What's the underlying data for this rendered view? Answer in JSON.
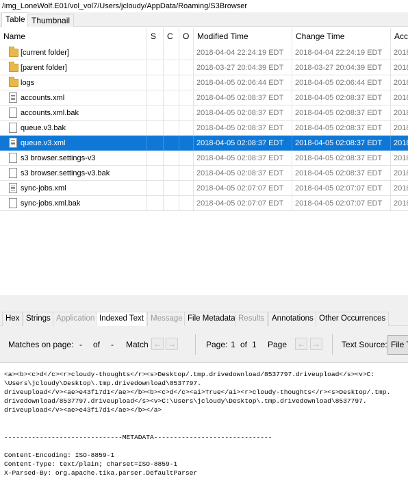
{
  "path": "/img_LoneWolf.E01/vol_vol7/Users/jcloudy/AppData/Roaming/S3Browser",
  "view_tabs": [
    "Table",
    "Thumbnail"
  ],
  "columns": [
    "Name",
    "S",
    "C",
    "O",
    "Modified Time",
    "Change Time",
    "Access"
  ],
  "rows": [
    {
      "name": "[current folder]",
      "icon": "folder-icon",
      "modified": "2018-04-04 22:24:19 EDT",
      "changed": "2018-04-04 22:24:19 EDT",
      "access": "2018"
    },
    {
      "name": "[parent folder]",
      "icon": "folder-icon",
      "modified": "2018-03-27 20:04:39 EDT",
      "changed": "2018-03-27 20:04:39 EDT",
      "access": "2018"
    },
    {
      "name": "logs",
      "icon": "folder-icon",
      "modified": "2018-04-05 02:06:44 EDT",
      "changed": "2018-04-05 02:06:44 EDT",
      "access": "2018"
    },
    {
      "name": "accounts.xml",
      "icon": "text-file-icon",
      "modified": "2018-04-05 02:08:37 EDT",
      "changed": "2018-04-05 02:08:37 EDT",
      "access": "2018"
    },
    {
      "name": "accounts.xml.bak",
      "icon": "file-icon",
      "modified": "2018-04-05 02:08:37 EDT",
      "changed": "2018-04-05 02:08:37 EDT",
      "access": "2018"
    },
    {
      "name": "queue.v3.bak",
      "icon": "file-icon",
      "modified": "2018-04-05 02:08:37 EDT",
      "changed": "2018-04-05 02:08:37 EDT",
      "access": "2018"
    },
    {
      "name": "queue.v3.xml",
      "icon": "text-file-icon",
      "modified": "2018-04-05 02:08:37 EDT",
      "changed": "2018-04-05 02:08:37 EDT",
      "access": "2018",
      "selected": true
    },
    {
      "name": "s3 browser.settings-v3",
      "icon": "file-icon",
      "modified": "2018-04-05 02:08:37 EDT",
      "changed": "2018-04-05 02:08:37 EDT",
      "access": "2018"
    },
    {
      "name": "s3 browser.settings-v3.bak",
      "icon": "file-icon",
      "modified": "2018-04-05 02:08:37 EDT",
      "changed": "2018-04-05 02:08:37 EDT",
      "access": "2018"
    },
    {
      "name": "sync-jobs.xml",
      "icon": "text-file-icon",
      "modified": "2018-04-05 02:07:07 EDT",
      "changed": "2018-04-05 02:07:07 EDT",
      "access": "2018"
    },
    {
      "name": "sync-jobs.xml.bak",
      "icon": "file-icon",
      "modified": "2018-04-05 02:07:07 EDT",
      "changed": "2018-04-05 02:07:07 EDT",
      "access": "2018"
    }
  ],
  "detail_tabs": [
    {
      "label": "Hex",
      "disabled": false
    },
    {
      "label": "Strings",
      "disabled": false
    },
    {
      "label": "Application",
      "disabled": true
    },
    {
      "label": "Indexed Text",
      "disabled": false,
      "active": true
    },
    {
      "label": "Message",
      "disabled": true
    },
    {
      "label": "File Metadata",
      "disabled": false
    },
    {
      "label": "Results",
      "disabled": true
    },
    {
      "label": "Annotations",
      "disabled": false
    },
    {
      "label": "Other Occurrences",
      "disabled": false
    }
  ],
  "match_bar": {
    "matches_label": "Matches on page:",
    "matches_current": "-",
    "of_label": "of",
    "matches_total": "-",
    "match_label": "Match",
    "page_label": "Page:",
    "page_current": "1",
    "page_of": "of",
    "page_total": "1",
    "page_nav_label": "Page",
    "text_source_label": "Text Source:",
    "text_source_value": "File Text"
  },
  "indexed_text": "<a><b><c>d</c><r>cloudy-thoughts</r><s>Desktop/.tmp.drivedownload/8537797.driveupload</s><v>C:\n\\Users\\jcloudy\\Desktop\\.tmp.drivedownload\\8537797.\ndriveupload</v><ae>e43f17d1</ae></b><b><c>d</c><ai>True</ai><r>cloudy-thoughts</r><s>Desktop/.tmp.\ndrivedownload/8537797.driveupload</s><v>C:\\Users\\jcloudy\\Desktop\\.tmp.drivedownload\\8537797.\ndriveupload</v><ae>e43f17d1</ae></b></a>\n\n\n------------------------------METADATA------------------------------\n\nContent-Encoding: ISO-8859-1\nContent-Type: text/plain; charset=ISO-8859-1\nX-Parsed-By: org.apache.tika.parser.DefaultParser"
}
